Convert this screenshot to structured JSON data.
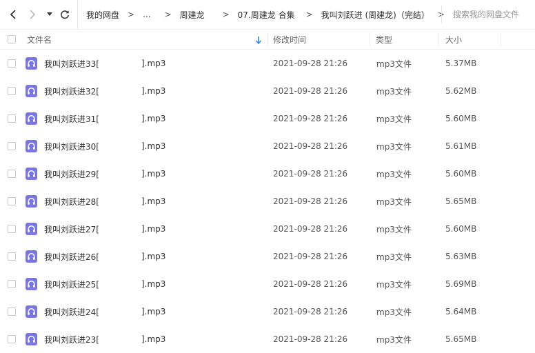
{
  "toolbar": {
    "back_icon": "chevron-left-icon",
    "forward_icon": "chevron-right-icon",
    "history_icon": "caret-down-icon",
    "refresh_icon": "refresh-icon",
    "breadcrumb": [
      "我的网盘",
      "...",
      "周建龙",
      "07.周建龙 合集",
      "我叫刘跃进 (周建龙)（完结）"
    ],
    "separator": ">",
    "search_placeholder": "搜索我的网盘文件"
  },
  "table": {
    "columns": [
      "文件名",
      "修改时间",
      "类型",
      "大小"
    ],
    "sort_icon": "sort-down-arrow-icon",
    "file_icon": "audio-file-icon",
    "accent_color": "#7b74e6",
    "rows": [
      {
        "name_prefix": "我叫刘跃进33[",
        "name_suffix": "].mp3",
        "modified": "2021-09-28 21:26",
        "type": "mp3文件",
        "size": "5.37MB"
      },
      {
        "name_prefix": "我叫刘跃进32[",
        "name_suffix": "].mp3",
        "modified": "2021-09-28 21:26",
        "type": "mp3文件",
        "size": "5.62MB"
      },
      {
        "name_prefix": "我叫刘跃进31[",
        "name_suffix": "].mp3",
        "modified": "2021-09-28 21:26",
        "type": "mp3文件",
        "size": "5.60MB"
      },
      {
        "name_prefix": "我叫刘跃进30[",
        "name_suffix": "].mp3",
        "modified": "2021-09-28 21:26",
        "type": "mp3文件",
        "size": "5.61MB"
      },
      {
        "name_prefix": "我叫刘跃进29[",
        "name_suffix": "].mp3",
        "modified": "2021-09-28 21:26",
        "type": "mp3文件",
        "size": "5.60MB"
      },
      {
        "name_prefix": "我叫刘跃进28[",
        "name_suffix": "].mp3",
        "modified": "2021-09-28 21:26",
        "type": "mp3文件",
        "size": "5.65MB"
      },
      {
        "name_prefix": "我叫刘跃进27[",
        "name_suffix": "].mp3",
        "modified": "2021-09-28 21:26",
        "type": "mp3文件",
        "size": "5.60MB"
      },
      {
        "name_prefix": "我叫刘跃进26[",
        "name_suffix": "].mp3",
        "modified": "2021-09-28 21:26",
        "type": "mp3文件",
        "size": "5.63MB"
      },
      {
        "name_prefix": "我叫刘跃进25[",
        "name_suffix": "].mp3",
        "modified": "2021-09-28 21:26",
        "type": "mp3文件",
        "size": "5.69MB"
      },
      {
        "name_prefix": "我叫刘跃进24[",
        "name_suffix": "].mp3",
        "modified": "2021-09-28 21:26",
        "type": "mp3文件",
        "size": "5.64MB"
      },
      {
        "name_prefix": "我叫刘跃进23[",
        "name_suffix": "].mp3",
        "modified": "2021-09-28 21:26",
        "type": "mp3文件",
        "size": "5.65MB"
      }
    ]
  }
}
